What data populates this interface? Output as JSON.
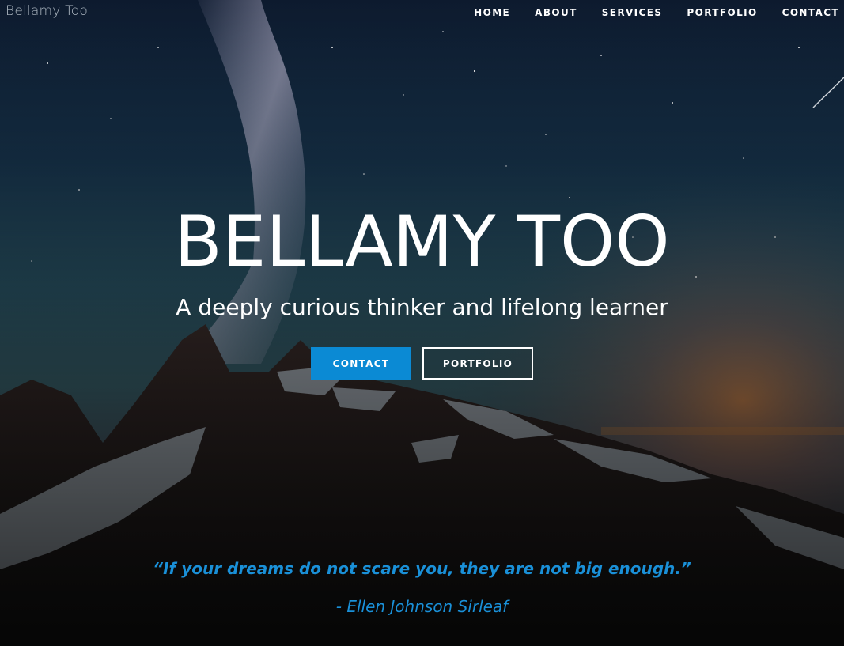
{
  "navbar": {
    "brand": "Bellamy Too",
    "links": [
      {
        "label": "HOME"
      },
      {
        "label": "ABOUT"
      },
      {
        "label": "SERVICES"
      },
      {
        "label": "PORTFOLIO"
      },
      {
        "label": "CONTACT"
      }
    ]
  },
  "hero": {
    "title": "BELLAMY TOO",
    "subtitle": "A deeply curious thinker and lifelong learner",
    "buttons": {
      "contact_label": "CONTACT",
      "portfolio_label": "PORTFOLIO"
    },
    "quote": "“If your dreams do not scare you, they are not big enough.”",
    "quote_author": "- Ellen Johnson Sirleaf"
  },
  "colors": {
    "accent": "#0b8ad4",
    "quote_text": "#1a90d8",
    "nav_text": "#ffffff"
  },
  "background": {
    "image": "night-sky-milky-way-over-snowy-mountain"
  }
}
